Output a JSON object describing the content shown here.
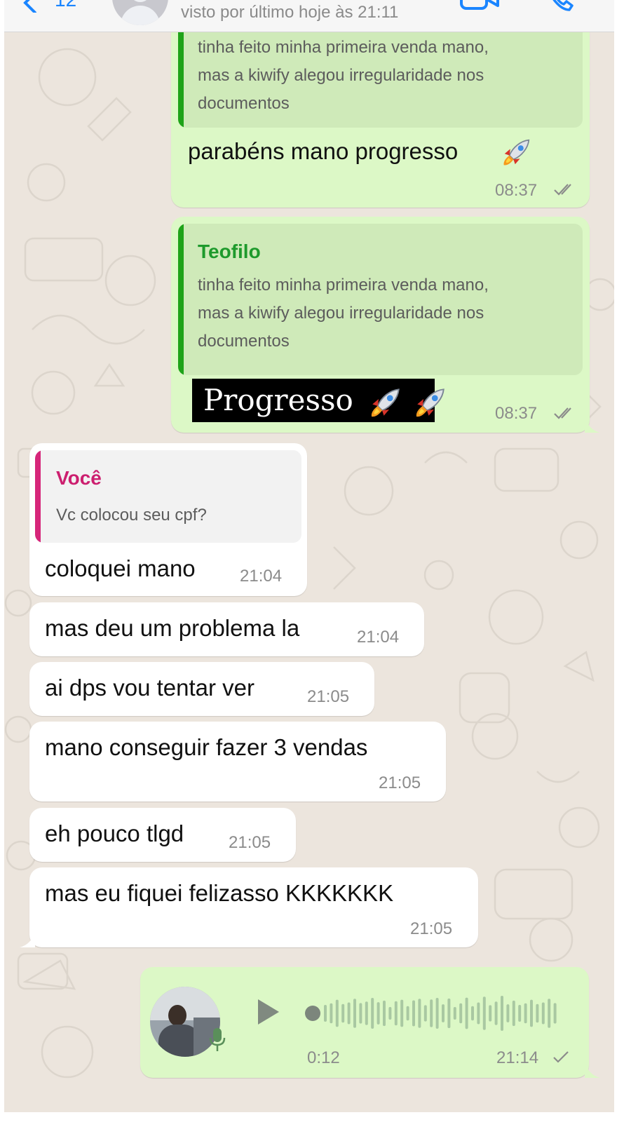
{
  "header": {
    "back_count": "12",
    "last_seen": "visto por último hoje às 21:11"
  },
  "messages": {
    "m1": {
      "quote_text": "tinha feito minha primeira venda mano,\nmas a kiwify alegou irregularidade nos\ndocumentos",
      "text": "parabéns mano progresso",
      "time": "08:37"
    },
    "m2": {
      "quote_name": "Teofilo",
      "quote_text": "tinha feito minha primeira venda mano,\nmas a kiwify alegou irregularidade nos\ndocumentos",
      "image_text": "Progresso",
      "time": "08:37"
    },
    "m3": {
      "quote_name": "Você",
      "quote_text": "Vc colocou seu cpf?",
      "text": "coloquei mano",
      "time": "21:04"
    },
    "m4": {
      "text": "mas deu um problema la",
      "time": "21:04"
    },
    "m5": {
      "text": "ai dps vou tentar ver",
      "time": "21:05"
    },
    "m6": {
      "text": "mano conseguir fazer 3 vendas",
      "time": "21:05"
    },
    "m7": {
      "text": "eh pouco tlgd",
      "time": "21:05"
    },
    "m8": {
      "text": "mas eu fiquei felizasso KKKKKKK",
      "time": "21:05"
    },
    "voice": {
      "duration": "0:12",
      "time": "21:14"
    }
  },
  "colors": {
    "outgoing_bubble": "#dcf8c6",
    "incoming_bubble": "#ffffff",
    "chat_background": "#ece5dd",
    "quote_bar_teofilo": "#1fa319",
    "quote_name_teofilo": "#1e9a2c",
    "quote_bar_voce": "#d6267a",
    "quote_name_voce": "#cc1f6f"
  },
  "icons": [
    "back-chevron-icon",
    "avatar-placeholder-icon",
    "video-call-icon",
    "phone-call-icon",
    "rocket-emoji",
    "double-check-icon",
    "single-check-icon",
    "play-icon",
    "microphone-icon"
  ]
}
